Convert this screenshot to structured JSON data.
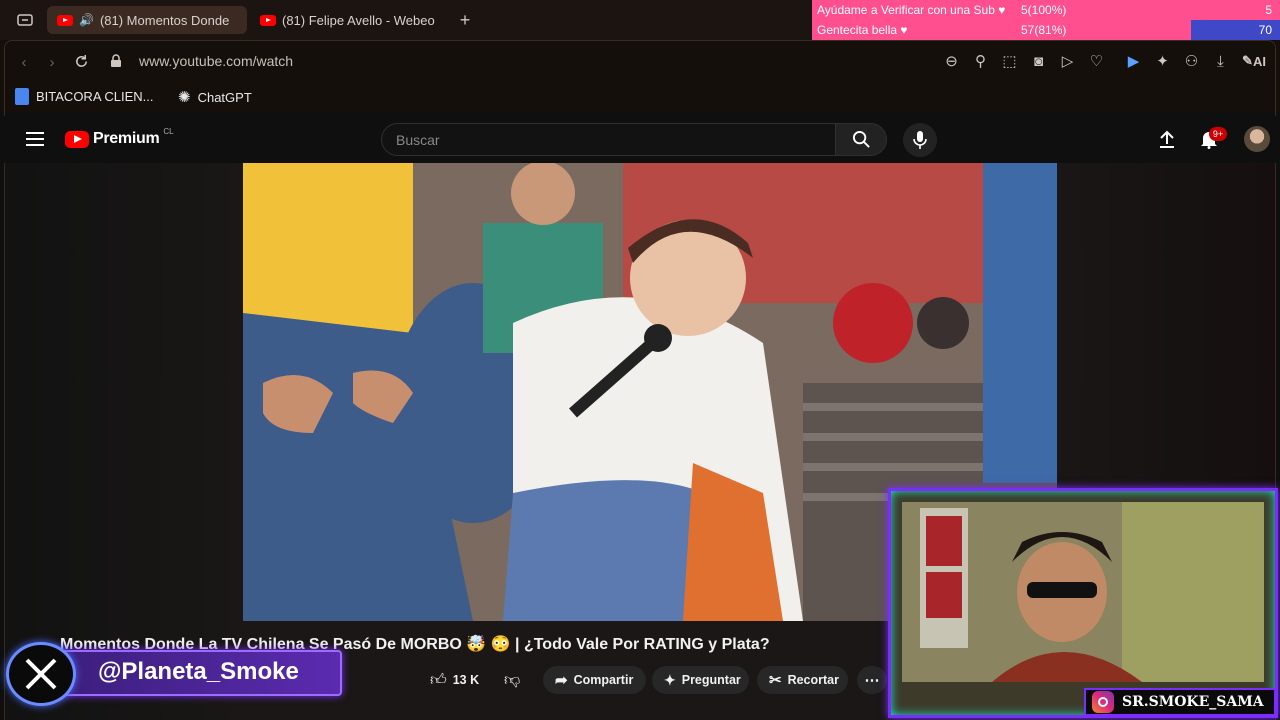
{
  "browser": {
    "tabs": [
      {
        "label": "(81) Momentos Donde",
        "active": true
      },
      {
        "label": "(81) Felipe Avello - Webeo"
      }
    ],
    "new_tab": "+",
    "url": "www.youtube.com/watch",
    "ai_label": "AI",
    "bookmarks": [
      {
        "label": "BITACORA CLIEN..."
      },
      {
        "label": "ChatGPT"
      }
    ]
  },
  "youtube": {
    "logo_text": "Premium",
    "region": "CL",
    "search_placeholder": "Buscar",
    "notifications": "9+",
    "video_title": "Momentos Donde La TV Chilena Se Pasó De MORBO 🤯 😳 | ¿Todo Vale Por RATING y Plata?",
    "actions": {
      "likes": "13 K",
      "share": "Compartir",
      "ask": "Preguntar",
      "clip": "Recortar"
    }
  },
  "overlays": {
    "goals": [
      {
        "label": "Ayúdame a Verificar con una Sub ♥",
        "progress": "5(100%)",
        "value": "5",
        "fraction": 1.0
      },
      {
        "label": "Gentecita bella ♥",
        "progress": "57(81%)",
        "value": "70",
        "fraction": 0.81
      }
    ],
    "x_handle": "@Planeta_Smoke",
    "instagram_handle": "SR.SMOKE_SAMA"
  },
  "colors": {
    "accent_red": "#ff0000",
    "goal_pink": "#ff4f8f",
    "goal_blue": "#3f49c8",
    "frame_purple": "#7b2cff",
    "frame_cyan": "#19e6c1"
  }
}
